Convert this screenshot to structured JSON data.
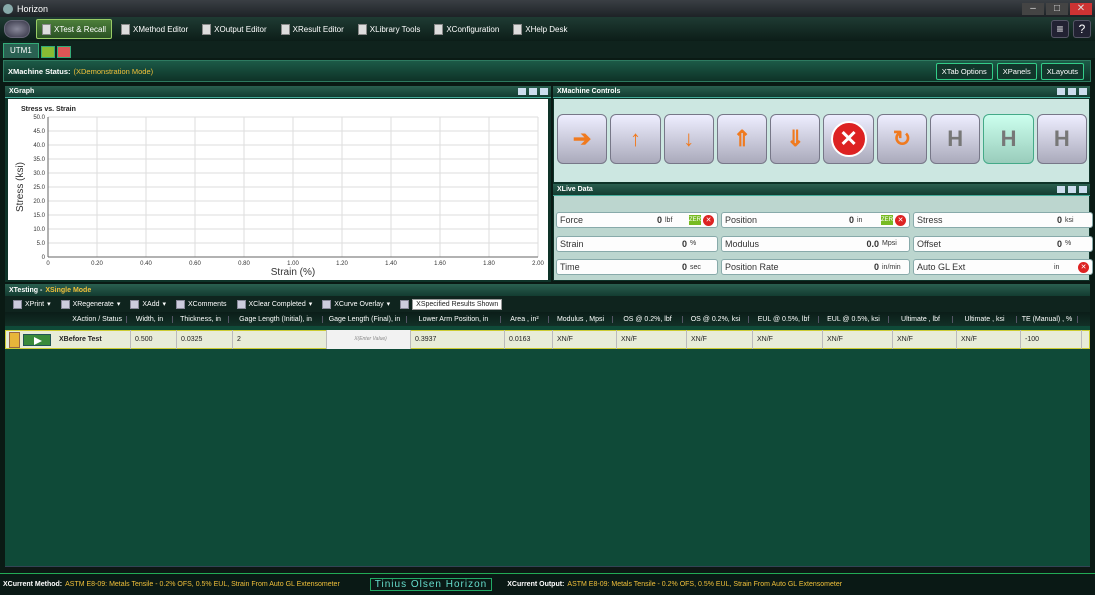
{
  "app_title": "Horizon",
  "menu": [
    {
      "label": "XTest & Recall",
      "active": true
    },
    {
      "label": "XMethod Editor"
    },
    {
      "label": "XOutput Editor"
    },
    {
      "label": "XResult Editor"
    },
    {
      "label": "XLibrary Tools"
    },
    {
      "label": "XConfiguration"
    },
    {
      "label": "XHelp Desk"
    }
  ],
  "tabs": {
    "machine": "UTM1"
  },
  "status": {
    "label": "XMachine Status:",
    "value": "(XDemonstration Mode)",
    "tab_options": "XTab Options",
    "panels": "XPanels",
    "layouts": "XLayouts"
  },
  "graph": {
    "panel_title": "XGraph"
  },
  "chart_data": {
    "type": "line",
    "title": "Stress vs. Strain",
    "xlabel": "Strain (%)",
    "ylabel": "Stress (ksi)",
    "xlim": [
      0,
      2
    ],
    "ylim": [
      0,
      50
    ],
    "x_ticks": [
      "0",
      "0.20",
      "0.40",
      "0.60",
      "0.80",
      "1.00",
      "1.20",
      "1.40",
      "1.60",
      "1.80",
      "2.00"
    ],
    "y_ticks": [
      "0",
      "5.0",
      "10.0",
      "15.0",
      "20.0",
      "25.0",
      "30.0",
      "35.0",
      "40.0",
      "45.0",
      "50.0"
    ],
    "series": [],
    "grid": true
  },
  "machine_controls": {
    "title": "XMachine Controls",
    "icons": [
      "run-test-icon",
      "up-arrow-icon",
      "down-arrow-icon",
      "jog-up-icon",
      "jog-down-icon",
      "stop-icon",
      "return-icon",
      "hold-icon",
      "hold-selected-icon",
      "hold-alt-icon"
    ]
  },
  "live": {
    "title": "XLive Data",
    "cells": [
      {
        "name": "Force",
        "value": "0",
        "unit": "lbf"
      },
      {
        "name": "Position",
        "value": "0",
        "unit": "in"
      },
      {
        "name": "Stress",
        "value": "0",
        "unit": "ksi"
      },
      {
        "name": "Strain",
        "value": "0",
        "unit": "%"
      },
      {
        "name": "Modulus",
        "value": "0.0",
        "unit": "Mpsi"
      },
      {
        "name": "Offset",
        "value": "0",
        "unit": "%"
      },
      {
        "name": "Time",
        "value": "0",
        "unit": "sec"
      },
      {
        "name": "Position Rate",
        "value": "0",
        "unit": "in/min"
      },
      {
        "name": "Auto GL Ext",
        "value": "",
        "unit": "in"
      }
    ]
  },
  "testing": {
    "title": "XTesting -",
    "mode": "XSingle Mode",
    "toolbar": [
      "XPrint",
      "XRegenerate",
      "XAdd",
      "XComments",
      "XClear Completed",
      "XCurve Overlay"
    ],
    "results_shown": "XSpecified Results Shown",
    "columns": [
      "XAction / Status",
      "Width, in",
      "Thickness, in",
      "Gage Length (Initial), in",
      "Gage Length (Final), in",
      "Lower Arm Position, in",
      "Area , in²",
      "Modulus , Mpsi",
      "OS @ 0.2%, lbf",
      "OS @ 0.2%, ksi",
      "EUL @ 0.5%, lbf",
      "EUL @ 0.5%, ksi",
      "Ultimate , lbf",
      "Ultimate , ksi",
      "TE (Manual) , %"
    ],
    "row": [
      "XBefore Test",
      "0.500",
      "0.0325",
      "2",
      "X(Enter Value)",
      "0.3937",
      "0.0163",
      "XN/F",
      "XN/F",
      "XN/F",
      "XN/F",
      "XN/F",
      "XN/F",
      "XN/F",
      "-100"
    ]
  },
  "footer": {
    "method_label": "XCurrent Method:",
    "method": "ASTM E8-09: Metals Tensile - 0.2% OFS, 0.5% EUL, Strain From Auto GL Extensometer",
    "brand": "Tinius Olsen Horizon",
    "output_label": "XCurrent Output:",
    "output": "ASTM E8-09: Metals Tensile - 0.2% OFS, 0.5% EUL, Strain From Auto GL Extensometer"
  }
}
